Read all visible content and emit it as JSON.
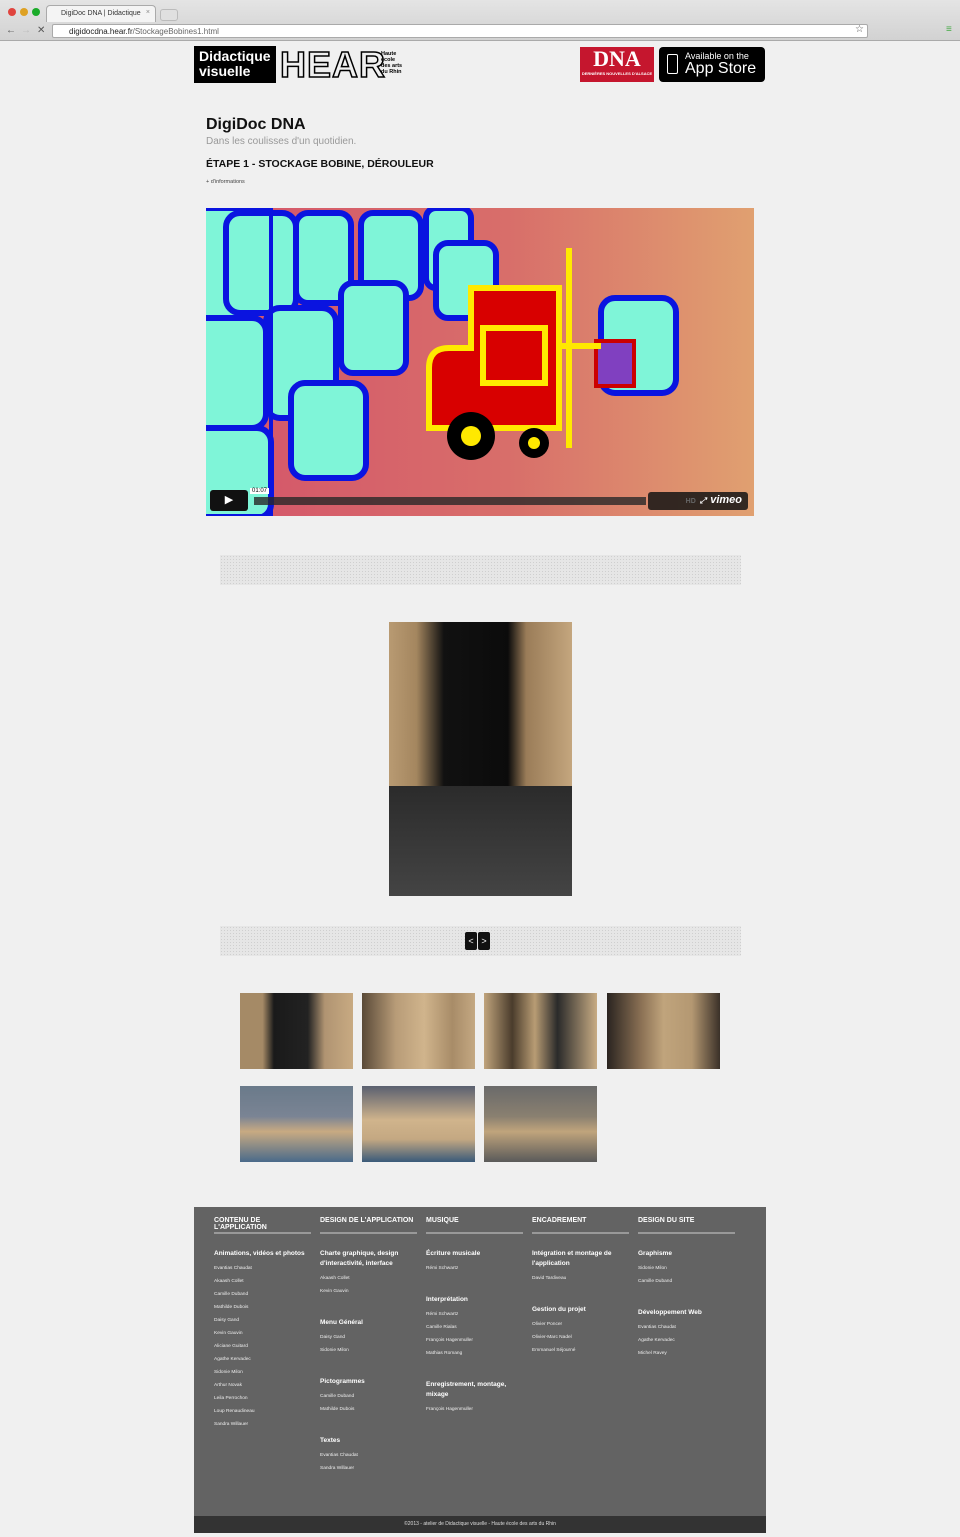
{
  "browser": {
    "tab_title": "DigiDoc DNA | Didactique",
    "url_host": "digidocdna.hear.fr",
    "url_path": "/StockageBobines1.html"
  },
  "header": {
    "logo_line1": "Didactique",
    "logo_line2": "visuelle",
    "hear": "HEAR",
    "hear_sub": [
      "Haute",
      "école",
      "des arts",
      "du Rhin"
    ],
    "dna": "DNA",
    "dna_sub": "DERNIÈRES NOUVELLES D'ALSACE",
    "appstore_line1": "Available on the",
    "appstore_line2": "App Store"
  },
  "page": {
    "title": "DigiDoc DNA",
    "subtitle": "Dans les coulisses d'un quotidien.",
    "step": "ÉTAPE 1 - STOCKAGE BOBINE, DÉROULEUR",
    "more": "+ d'informations"
  },
  "video": {
    "time": "01:07",
    "brand": "vimeo",
    "hd": "HD",
    "progress": 0
  },
  "gallery": {
    "prev": "<",
    "next": ">",
    "thumbnail_count": 7
  },
  "footer": {
    "columns": [
      {
        "heading": "CONTENU DE L'APPLICATION",
        "sections": [
          {
            "title": "Animations, vidéos et photos",
            "names": [
              "Evantias Chaudat",
              "Akaash Collet",
              "Camille Duband",
              "Mathilde Dubois",
              "Daisy Gand",
              "Kevin Gauvin",
              "Aliciane Guitard",
              "Agathe Kervadec",
              "Sidonie Milon",
              "Arthur Novak",
              "Leila Perrochon",
              "Loup Renaudineau",
              "Sandra Willauer"
            ]
          }
        ]
      },
      {
        "heading": "DESIGN DE L'APPLICATION",
        "sections": [
          {
            "title": "Charte graphique, design d'interactivité, interface",
            "names": [
              "Akaash Collet",
              "Kevin Gauvin"
            ]
          },
          {
            "title": "Menu Général",
            "names": [
              "Daisy Gand",
              "Sidonie Milon"
            ]
          },
          {
            "title": "Pictogrammes",
            "names": [
              "Camille Duband",
              "Mathilde Dubois"
            ]
          },
          {
            "title": "Textes",
            "names": [
              "Evantias Chaudat",
              "Sandra Willauer"
            ]
          }
        ]
      },
      {
        "heading": "MUSIQUE",
        "sections": [
          {
            "title": "Écriture musicale",
            "names": [
              "Rémi Schwartz"
            ]
          },
          {
            "title": "Interprétation",
            "names": [
              "Rémi Schwartz",
              "Camille Rialas",
              "François Hagenmuller",
              "Mathias Romang"
            ]
          },
          {
            "title": "Enregistrement, montage, mixage",
            "names": [
              "François Hagenmuller"
            ]
          }
        ]
      },
      {
        "heading": "ENCADREMENT",
        "sections": [
          {
            "title": "Intégration et montage de l'application",
            "names": [
              "David Tardiveau"
            ]
          },
          {
            "title": "Gestion du projet",
            "names": [
              "Olivier Poncer",
              "Olivier-Marc Nadel",
              "Emmanuel Séjourné"
            ]
          }
        ]
      },
      {
        "heading": "DESIGN DU SITE",
        "sections": [
          {
            "title": "Graphisme",
            "names": [
              "Sidonie Milon",
              "Camille Duband"
            ]
          },
          {
            "title": "Développement Web",
            "names": [
              "Evantias Chaudat",
              "Agathe Kervadec",
              "Michel Ravey"
            ]
          }
        ]
      }
    ],
    "copyright": "©2013 - atelier de Didactique visuelle - Haute école des arts du Rhin"
  }
}
